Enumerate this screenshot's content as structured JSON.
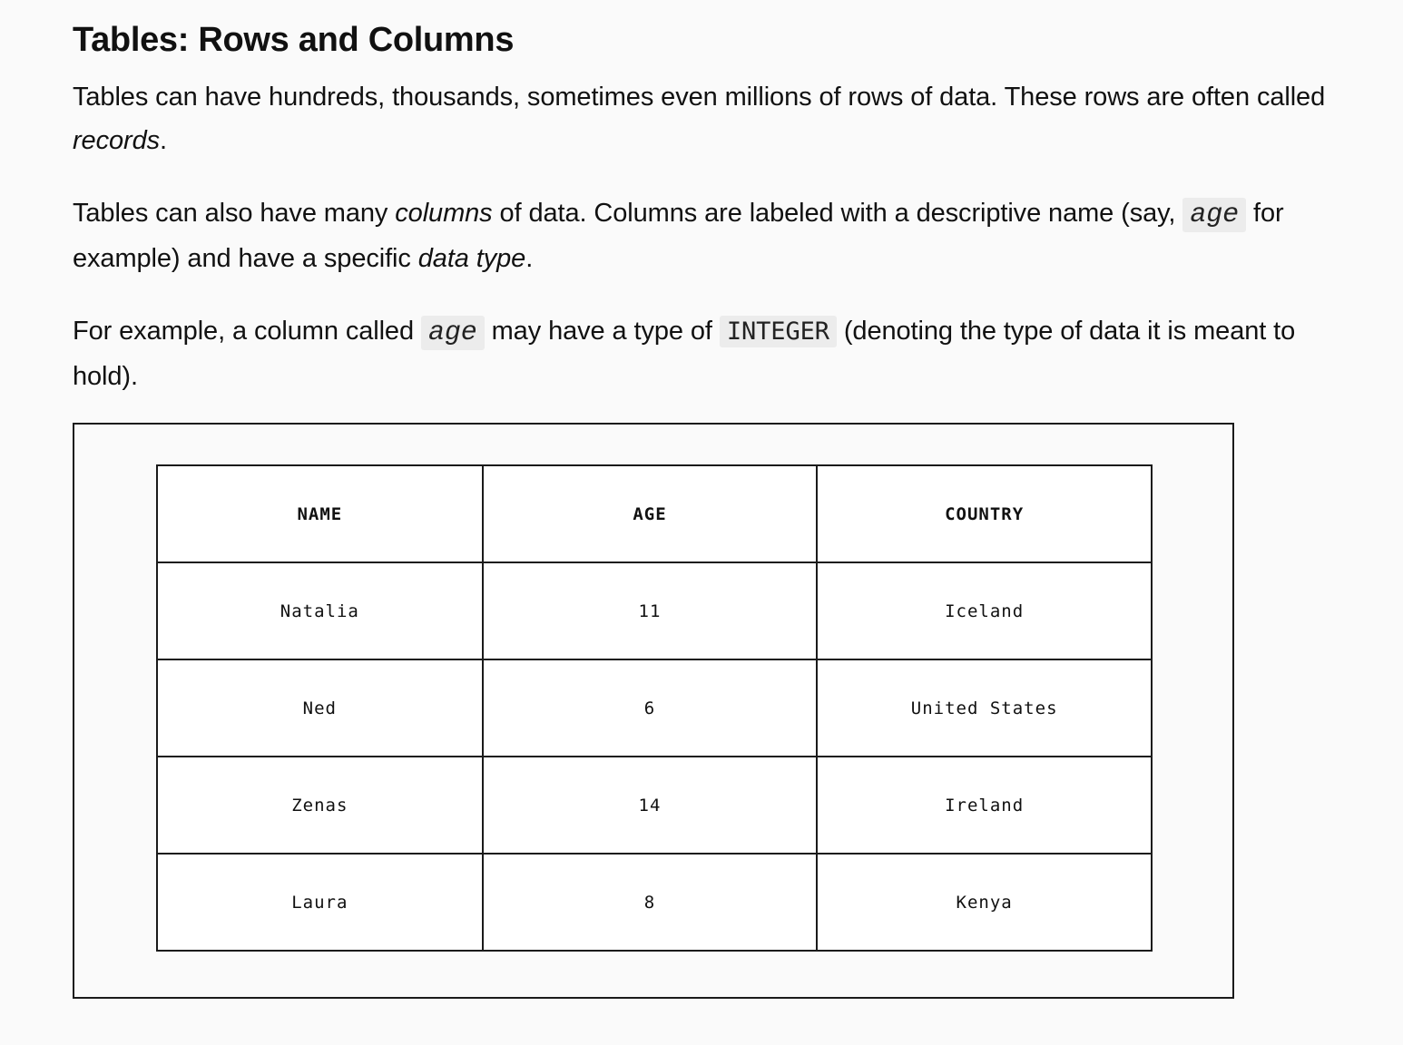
{
  "heading": "Tables: Rows and Columns",
  "paragraph1": {
    "text_a": "Tables can have hundreds, thousands, sometimes even millions of rows of data. These rows are often called ",
    "em": "records",
    "text_b": "."
  },
  "paragraph2": {
    "text_a": "Tables can also have many ",
    "em1": "columns",
    "text_b": " of data. Columns are labeled with a descriptive name (say, ",
    "code": "age",
    "text_c": " for example) and have a specific ",
    "em2": "data type",
    "text_d": "."
  },
  "paragraph3": {
    "text_a": "For example, a column called ",
    "code1": "age",
    "text_b": " may have a type of ",
    "code2": "INTEGER",
    "text_c": " (denoting the type of data it is meant to hold)."
  },
  "table": {
    "headers": [
      "NAME",
      "AGE",
      "COUNTRY"
    ],
    "rows": [
      [
        "Natalia",
        "11",
        "Iceland"
      ],
      [
        "Ned",
        "6",
        "United States"
      ],
      [
        "Zenas",
        "14",
        "Ireland"
      ],
      [
        "Laura",
        "8",
        "Kenya"
      ]
    ]
  }
}
